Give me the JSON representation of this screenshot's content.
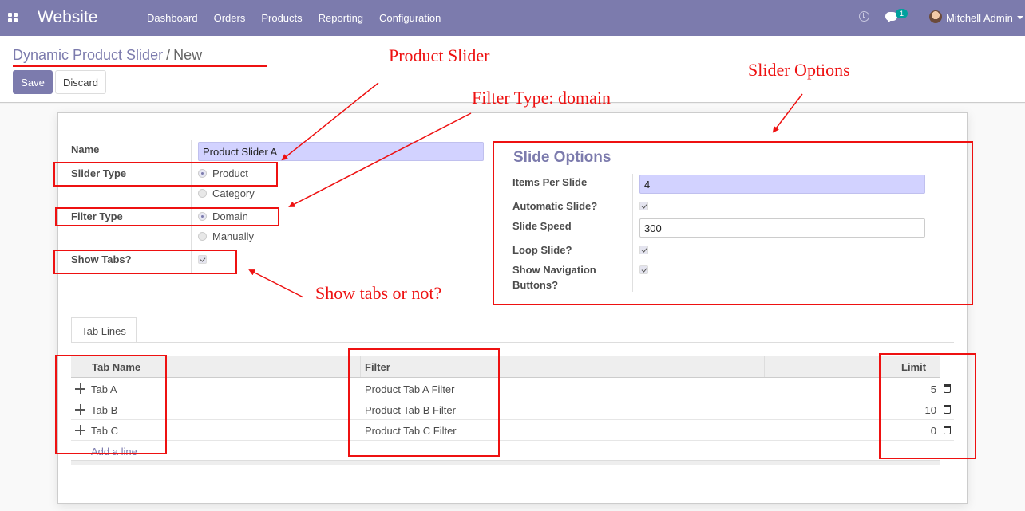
{
  "navbar": {
    "brand": "Website",
    "menu": [
      "Dashboard",
      "Orders",
      "Products",
      "Reporting",
      "Configuration"
    ],
    "badge": "1",
    "user": "Mitchell Admin"
  },
  "breadcrumb": {
    "parent": "Dynamic Product Slider",
    "separator": "/",
    "current": "New"
  },
  "buttons": {
    "save": "Save",
    "discard": "Discard"
  },
  "form": {
    "name_label": "Name",
    "name_value": "Product Slider A",
    "slider_type_label": "Slider Type",
    "slider_type_options": [
      "Product",
      "Category"
    ],
    "slider_type_selected": "Product",
    "filter_type_label": "Filter Type",
    "filter_type_options": [
      "Domain",
      "Manually"
    ],
    "filter_type_selected": "Domain",
    "show_tabs_label": "Show Tabs?",
    "show_tabs": true
  },
  "slide_options": {
    "title": "Slide Options",
    "items_per_slide_label": "Items Per Slide",
    "items_per_slide": "4",
    "automatic_slide_label": "Automatic Slide?",
    "automatic_slide": true,
    "slide_speed_label": "Slide Speed",
    "slide_speed": "300",
    "loop_slide_label": "Loop Slide?",
    "loop_slide": true,
    "nav_buttons_label_1": "Show Navigation",
    "nav_buttons_label_2": "Buttons?",
    "nav_buttons": true
  },
  "notebook": {
    "tab": "Tab Lines",
    "columns": [
      "Tab Name",
      "Filter",
      "Limit"
    ],
    "rows": [
      {
        "name": "Tab A",
        "filter": "Product Tab A Filter",
        "limit": "5"
      },
      {
        "name": "Tab B",
        "filter": "Product Tab B Filter",
        "limit": "10"
      },
      {
        "name": "Tab C",
        "filter": "Product Tab C Filter",
        "limit": "0"
      }
    ],
    "add_line": "Add a line"
  },
  "annotations": {
    "product_slider": "Product Slider",
    "filter_type": "Filter Type: domain",
    "slider_options": "Slider Options",
    "show_tabs": "Show tabs or not?"
  },
  "colors": {
    "brand": "#7c7bad",
    "annotation": "#ee1111",
    "required_field": "#d2d2ff"
  }
}
